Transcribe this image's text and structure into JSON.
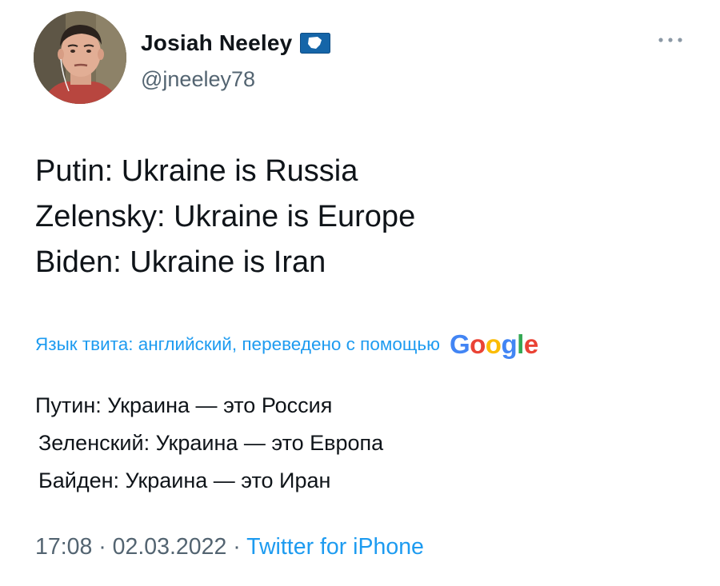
{
  "author": {
    "display_name": "Josiah Neeley",
    "handle": "@jneeley78",
    "avatar_icon": "profile-photo-man",
    "badge_icon": "flag-icon"
  },
  "tweet": {
    "lines": [
      "Putin: Ukraine is Russia",
      "Zelensky: Ukraine is Europe",
      "Biden: Ukraine is Iran"
    ]
  },
  "translation": {
    "label": "Язык твита: английский, переведено с помощью",
    "provider": "Google",
    "lines": [
      "Путин: Украина — это Россия",
      "Зеленский: Украина — это Европа",
      "Байден: Украина — это Иран"
    ]
  },
  "meta": {
    "time": "17:08",
    "date": "02.03.2022",
    "separator": "·",
    "source": "Twitter for iPhone"
  },
  "colors": {
    "text": "#0f1419",
    "secondary": "#536471",
    "accent": "#1d9bf0",
    "google_blue": "#4285F4",
    "google_red": "#EA4335",
    "google_yellow": "#FBBC05",
    "google_green": "#34A853"
  },
  "more_icon": "more-horizontal-icon"
}
